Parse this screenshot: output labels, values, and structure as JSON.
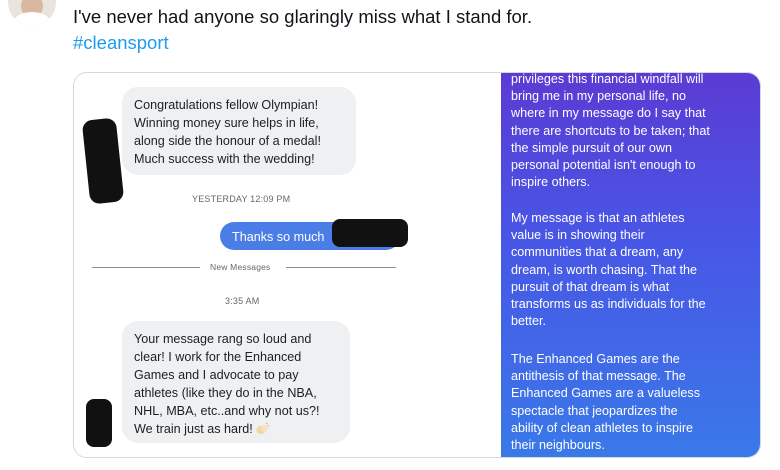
{
  "tweet": {
    "text": "I've never had anyone so glaringly miss what I stand for.",
    "hashtag": "#cleansport"
  },
  "dm": {
    "message_1_lines": [
      "Congratulations fellow Olympian!",
      "Winning money sure helps in life,",
      "along side the honour of a medal!",
      "Much success with the wedding!"
    ],
    "timestamp_1": "YESTERDAY 12:09 PM",
    "reply": "Thanks so much",
    "new_messages_label": "New Messages",
    "timestamp_2": "3:35 AM",
    "message_2_lines": [
      "Your message rang so loud and",
      "clear! I work for the Enhanced",
      "Games and I advocate to pay",
      "athletes (like they do in the NBA,",
      "NHL, MBA, etc..and why not us?!",
      "We train just as hard!"
    ],
    "emoji": "clapping-hands"
  },
  "statement": {
    "para_1_lines": [
      "privileges this financial windfall will",
      "bring me in my personal life, no",
      "where in my message do I say that",
      "there are shortcuts to be taken; that",
      "the simple pursuit of our own",
      "personal potential isn't enough to",
      "inspire others."
    ],
    "para_2_lines": [
      "My message is that an athletes",
      "value is in showing their",
      "communities that a dream, any",
      "dream, is worth chasing. That the",
      "pursuit of that dream is what",
      "transforms us as individuals for the",
      "better."
    ],
    "para_3_lines": [
      "The Enhanced Games are the",
      "antithesis of that message. The",
      "Enhanced Games are a valueless",
      "spectacle that jeopardizes the",
      "ability of clean athletes to inspire",
      "their neighbours."
    ]
  }
}
